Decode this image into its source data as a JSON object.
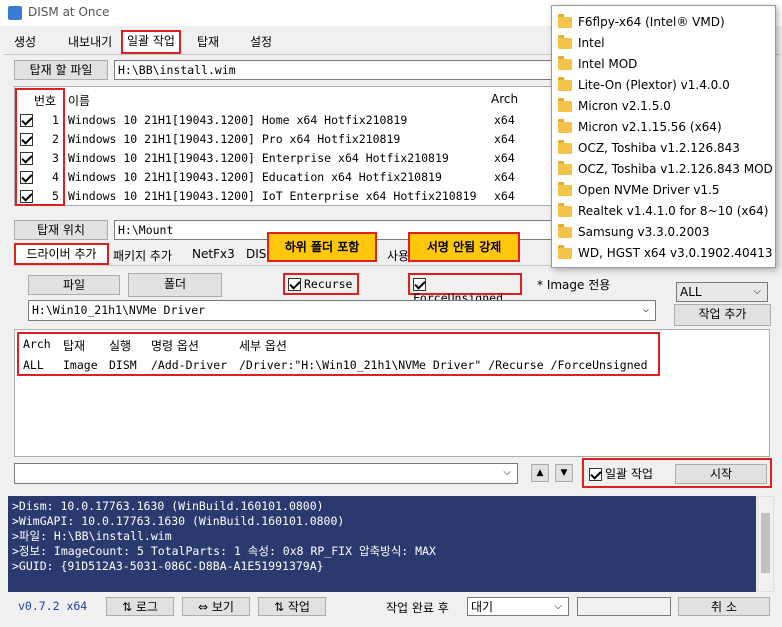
{
  "window": {
    "title": "DISM at Once"
  },
  "tabs": [
    {
      "label": "생성"
    },
    {
      "label": "내보내기"
    },
    {
      "label": "일괄 작업"
    },
    {
      "label": "탑재"
    },
    {
      "label": "설정"
    }
  ],
  "mount_file": {
    "button": "탑재 할 파일",
    "value": "H:\\BB\\install.wim"
  },
  "images": {
    "headers": {
      "num": "번호",
      "name": "이름",
      "arch": "Arch"
    },
    "rows": [
      {
        "num": "1",
        "name": "Windows 10 21H1[19043.1200] Home x64 Hotfix210819",
        "arch": "x64"
      },
      {
        "num": "2",
        "name": "Windows 10 21H1[19043.1200] Pro x64 Hotfix210819",
        "arch": "x64"
      },
      {
        "num": "3",
        "name": "Windows 10 21H1[19043.1200] Enterprise x64 Hotfix210819",
        "arch": "x64"
      },
      {
        "num": "4",
        "name": "Windows 10 21H1[19043.1200] Education x64 Hotfix210819",
        "arch": "x64"
      },
      {
        "num": "5",
        "name": "Windows 10 21H1[19043.1200] IoT Enterprise x64 Hotfix210819",
        "arch": "x64"
      }
    ]
  },
  "mount_location": {
    "button": "탑재 위치",
    "value": "H:\\Mount"
  },
  "subtabs": [
    {
      "label": "드라이버 추가"
    },
    {
      "label": "패키지 추가"
    },
    {
      "label": "NetFx3"
    },
    {
      "label": "DIS"
    },
    {
      "label": "사용"
    }
  ],
  "callouts": {
    "subfolder": "하위 폴더 포함",
    "force_unsigned": "서명 안됨 강제"
  },
  "driver": {
    "file_button": "파일",
    "folder_button": "폴더",
    "recurse_label": "Recurse",
    "force_unsigned_label": "ForceUnsigned",
    "image_only_note": "* Image 전용",
    "path": "H:\\Win10_21h1\\NVMe Driver"
  },
  "arch_select": {
    "value": "ALL"
  },
  "add_task_button": "작업 추가",
  "task_table": {
    "headers": {
      "arch": "Arch",
      "mount": "탑재",
      "run": "실행",
      "cmd": "명령 옵션",
      "detail": "세부 옵션"
    },
    "rows": [
      {
        "arch": "ALL",
        "mount": "Image",
        "run": "DISM",
        "cmd": "/Add-Driver",
        "detail": "/Driver:\"H:\\Win10_21h1\\NVMe Driver\" /Recurse /ForceUnsigned"
      }
    ]
  },
  "batch": {
    "checkbox_label": "일괄 작업",
    "start_button": "시작",
    "up": "▲",
    "down": "▼"
  },
  "log_lines": [
    ">Dism: 10.0.17763.1630 (WinBuild.160101.0800)",
    ">WimGAPI: 10.0.17763.1630 (WinBuild.160101.0800)",
    ">파일: H:\\BB\\install.wim",
    ">정보: ImageCount: 5  TotalParts: 1  속성: 0x8 RP_FIX  압축방식: MAX",
    ">GUID: {91D512A3-5031-086C-D8BA-A1E51991379A}"
  ],
  "footer": {
    "version": "v0.7.2 x64",
    "log_button": "⇅ 로그",
    "view_button": "⇔ 보기",
    "task_button": "⇅ 작업",
    "after_label": "작업 완료 후",
    "after_value": "대기",
    "cancel_button": "취 소"
  },
  "dropdown_items": [
    "F6flpy-x64 (Intel® VMD)",
    "Intel",
    "Intel MOD",
    "Lite-On (Plextor) v1.4.0.0",
    "Micron v2.1.5.0",
    "Micron v2.1.15.56 (x64)",
    "OCZ, Toshiba v1.2.126.843",
    "OCZ, Toshiba v1.2.126.843 MOD",
    "Open NVMe Driver v1.5",
    "Realtek v1.4.1.0 for 8~10 (x64)",
    "Samsung v3.3.0.2003",
    "WD, HGST x64 v3.0.1902.40413"
  ],
  "colors": {
    "log_bg": "#2b3a6e",
    "callout": "#ffc70a",
    "highlight_red": "#e02020"
  }
}
